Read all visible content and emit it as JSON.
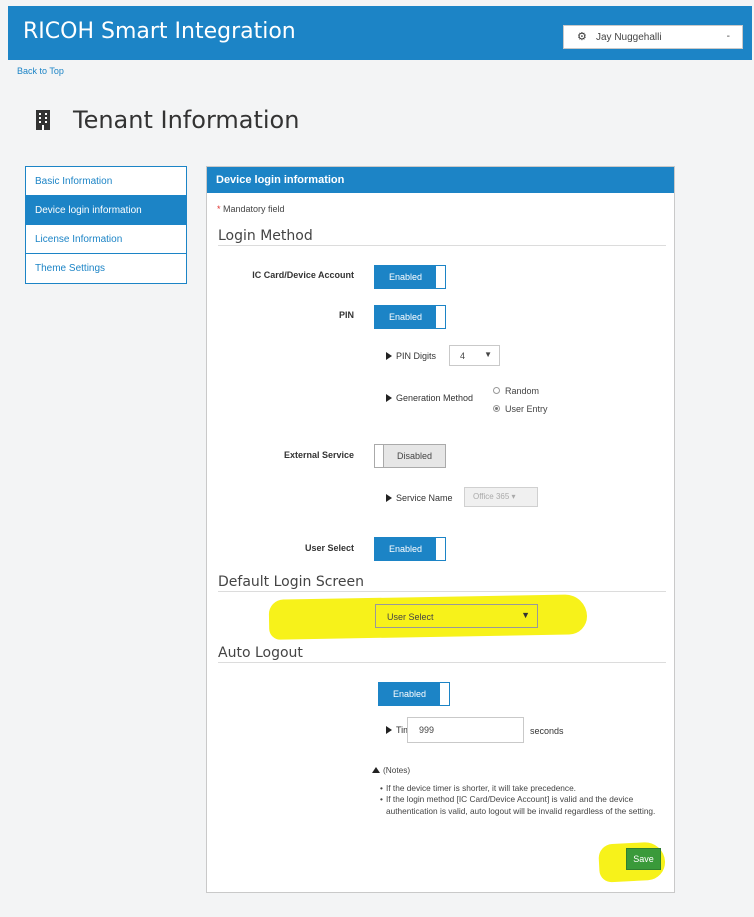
{
  "header": {
    "brand": "RICOH Smart Integration",
    "user_name": "Jay Nuggehalli",
    "user_icon": "gear-icon",
    "caret": "-"
  },
  "back_link": "Back to Top",
  "page": {
    "title": "Tenant Information",
    "title_icon": "building-icon"
  },
  "sidebar": {
    "items": [
      {
        "label": "Basic Information",
        "active": false
      },
      {
        "label": "Device login information",
        "active": true
      },
      {
        "label": "License Information",
        "active": false
      },
      {
        "label": "Theme Settings",
        "active": false
      }
    ]
  },
  "panel": {
    "title": "Device login information",
    "mandatory_star": "*",
    "mandatory_text": "Mandatory field",
    "login_method": {
      "heading": "Login Method",
      "ic_card": {
        "label": "IC Card/Device Account",
        "state": "Enabled"
      },
      "pin": {
        "label": "PIN",
        "state": "Enabled",
        "digits_label": "PIN Digits",
        "digits_value": "4",
        "generation_label": "Generation Method",
        "options": [
          "Random",
          "User Entry"
        ],
        "selected": "User Entry"
      },
      "external_service": {
        "label": "External Service",
        "state": "Disabled",
        "service_name_label": "Service Name",
        "service_name_value": "Office 365 ▾"
      },
      "user_select": {
        "label": "User Select",
        "state": "Enabled"
      }
    },
    "default_login": {
      "heading": "Default Login Screen",
      "value": "User Select"
    },
    "auto_logout": {
      "heading": "Auto Logout",
      "state": "Enabled",
      "timer_label": "Timer",
      "timer_star": "*",
      "timer_value": "999",
      "timer_unit": "seconds",
      "notes_label": "(Notes)",
      "notes": [
        "If the device timer is shorter, it will take precedence.",
        "If the login method [IC Card/Device Account] is valid and the device authentication is valid, auto logout will be invalid regardless of the setting."
      ]
    },
    "save_label": "Save"
  },
  "colors": {
    "brand_blue": "#1c84c6",
    "highlight_yellow": "#f7f21a",
    "save_green": "#3a9a3a"
  }
}
